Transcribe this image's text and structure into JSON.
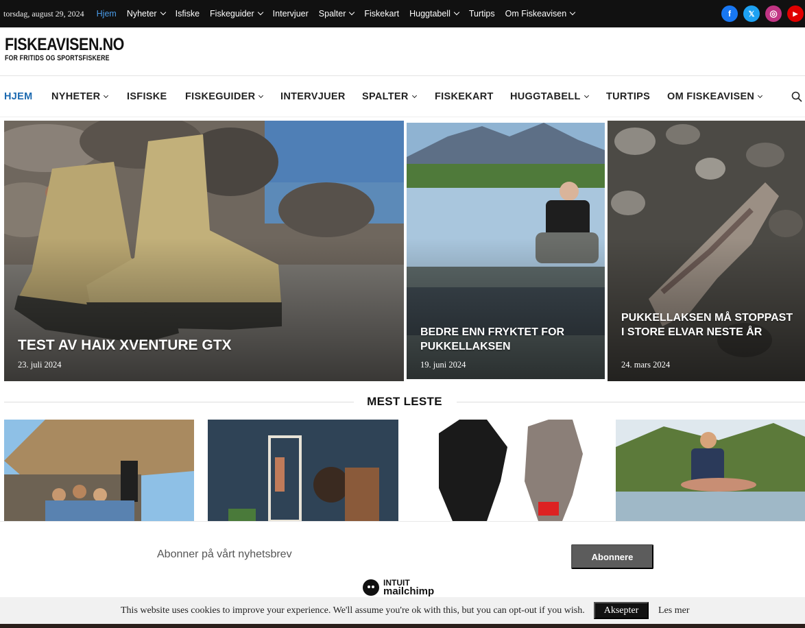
{
  "topbar": {
    "date": "torsdag, august 29, 2024",
    "nav": [
      {
        "label": "Hjem",
        "active": true,
        "dropdown": false
      },
      {
        "label": "Nyheter",
        "active": false,
        "dropdown": true
      },
      {
        "label": "Isfiske",
        "active": false,
        "dropdown": false
      },
      {
        "label": "Fiskeguider",
        "active": false,
        "dropdown": true
      },
      {
        "label": "Intervjuer",
        "active": false,
        "dropdown": false
      },
      {
        "label": "Spalter",
        "active": false,
        "dropdown": true
      },
      {
        "label": "Fiskekart",
        "active": false,
        "dropdown": false
      },
      {
        "label": "Huggtabell",
        "active": false,
        "dropdown": true
      },
      {
        "label": "Turtips",
        "active": false,
        "dropdown": false
      },
      {
        "label": "Om Fiskeavisen",
        "active": false,
        "dropdown": true
      }
    ],
    "social": [
      {
        "icon": "facebook-icon",
        "glyph": "f",
        "color": "#1877f2"
      },
      {
        "icon": "x-twitter-icon",
        "glyph": "𝕏",
        "color": "#1da1f2"
      },
      {
        "icon": "instagram-icon",
        "glyph": "◎",
        "color": "#c13584"
      },
      {
        "icon": "youtube-icon",
        "glyph": "▶",
        "color": "#e00000"
      }
    ]
  },
  "logo": {
    "title": "FISKEAVISEN.NO",
    "tagline": "FOR FRITIDS OG SPORTSFISKERE"
  },
  "mainnav": [
    {
      "label": "HJEM",
      "active": true,
      "dropdown": false
    },
    {
      "label": "NYHETER",
      "active": false,
      "dropdown": true
    },
    {
      "label": "ISFISKE",
      "active": false,
      "dropdown": false
    },
    {
      "label": "FISKEGUIDER",
      "active": false,
      "dropdown": true
    },
    {
      "label": "INTERVJUER",
      "active": false,
      "dropdown": false
    },
    {
      "label": "SPALTER",
      "active": false,
      "dropdown": true
    },
    {
      "label": "FISKEKART",
      "active": false,
      "dropdown": false
    },
    {
      "label": "HUGGTABELL",
      "active": false,
      "dropdown": true
    },
    {
      "label": "TURTIPS",
      "active": false,
      "dropdown": false
    },
    {
      "label": "OM FISKEAVISEN",
      "active": false,
      "dropdown": true
    }
  ],
  "hero": [
    {
      "title": "Test av HAIX Xventure GTX",
      "date": "23. juli 2024"
    },
    {
      "title": "Bedre enn fryktet for pukkellaksen",
      "date": "19. juni 2024"
    },
    {
      "title": "Pukkellaksen må stoppast i store elvar neste år",
      "date": "24. mars 2024"
    }
  ],
  "most_read": {
    "title": "MEST LESTE"
  },
  "newsletter": {
    "text": "Abonner på vårt nyhetsbrev",
    "button": "Abonnere",
    "brand_top": "INTUIT",
    "brand_bottom": "mailchimp"
  },
  "cookie": {
    "message": "This website uses cookies to improve your experience. We'll assume you're ok with this, but you can opt-out if you wish.",
    "accept": "Aksepter",
    "more": "Les mer"
  }
}
